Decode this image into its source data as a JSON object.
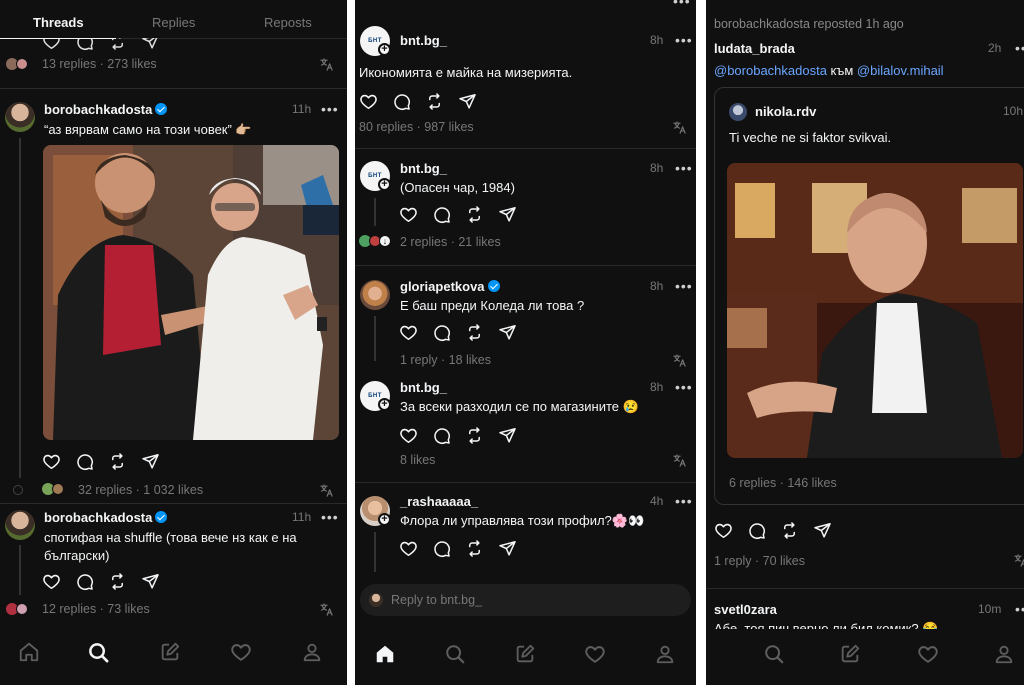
{
  "panel1": {
    "tabs": [
      "Threads",
      "Replies",
      "Reposts"
    ],
    "active_tab": "Threads",
    "top_stats": "13 replies · 273 likes",
    "post1": {
      "username": "borobachkadosta",
      "time": "11h",
      "text": "“аз вярвам само на този човек” 👉🏼",
      "stats": "32 replies · 1 032 likes"
    },
    "post2": {
      "username": "borobachkadosta",
      "time": "11h",
      "text_line1": "спотифая на shuffle (това вече нз как е на",
      "text_line2": "български)",
      "stats": "12 replies · 73 likes"
    }
  },
  "panel2": {
    "posts": [
      {
        "username": "bnt.bg_",
        "time": "8h",
        "text": "Икономията е майка на мизерията.",
        "stats": "80 replies · 987 likes"
      },
      {
        "username": "bnt.bg_",
        "time": "8h",
        "text": "(Опасен чар, 1984)",
        "stats": "2 replies · 21 likes"
      },
      {
        "username": "gloriapetkova",
        "time": "8h",
        "text": "Е баш преди Коледа ли това ?",
        "stats": "1 reply · 18 likes"
      },
      {
        "username": "bnt.bg_",
        "time": "8h",
        "text": "За всеки разходил се по магазините 😢",
        "stats": "8 likes"
      },
      {
        "username": "_rashaaaaa_",
        "time": "4h",
        "text": "Флора ли управлява този профил?🌸👀"
      }
    ],
    "reply_placeholder": "Reply to bnt.bg_",
    "avatar_brand": "БНТ"
  },
  "panel3": {
    "repost_line": "borobachkadosta reposted 1h ago",
    "post": {
      "username": "ludata_brada",
      "time": "2h",
      "mention1": "@borobachkadosta",
      "connector": " към ",
      "mention2": "@bilalov.mihail",
      "stats": "1 reply · 70 likes"
    },
    "quoted": {
      "username": "nikola.rdv",
      "time": "10h",
      "text": "Ti veche ne si faktor svikvai.",
      "stats": "6 replies · 146 likes"
    },
    "next_post": {
      "username": "svetl0zara",
      "time": "10m",
      "text": "Абе, тоя пич верно ли бил комик? 😂"
    }
  },
  "icons": {
    "home": "home-icon",
    "search": "search-icon",
    "compose": "compose-icon",
    "activity": "heart-icon",
    "profile": "profile-icon",
    "translate": "translate-icon"
  },
  "colors": {
    "background": "#101010",
    "mention": "#6aa6ff",
    "verified": "#0095f6"
  }
}
